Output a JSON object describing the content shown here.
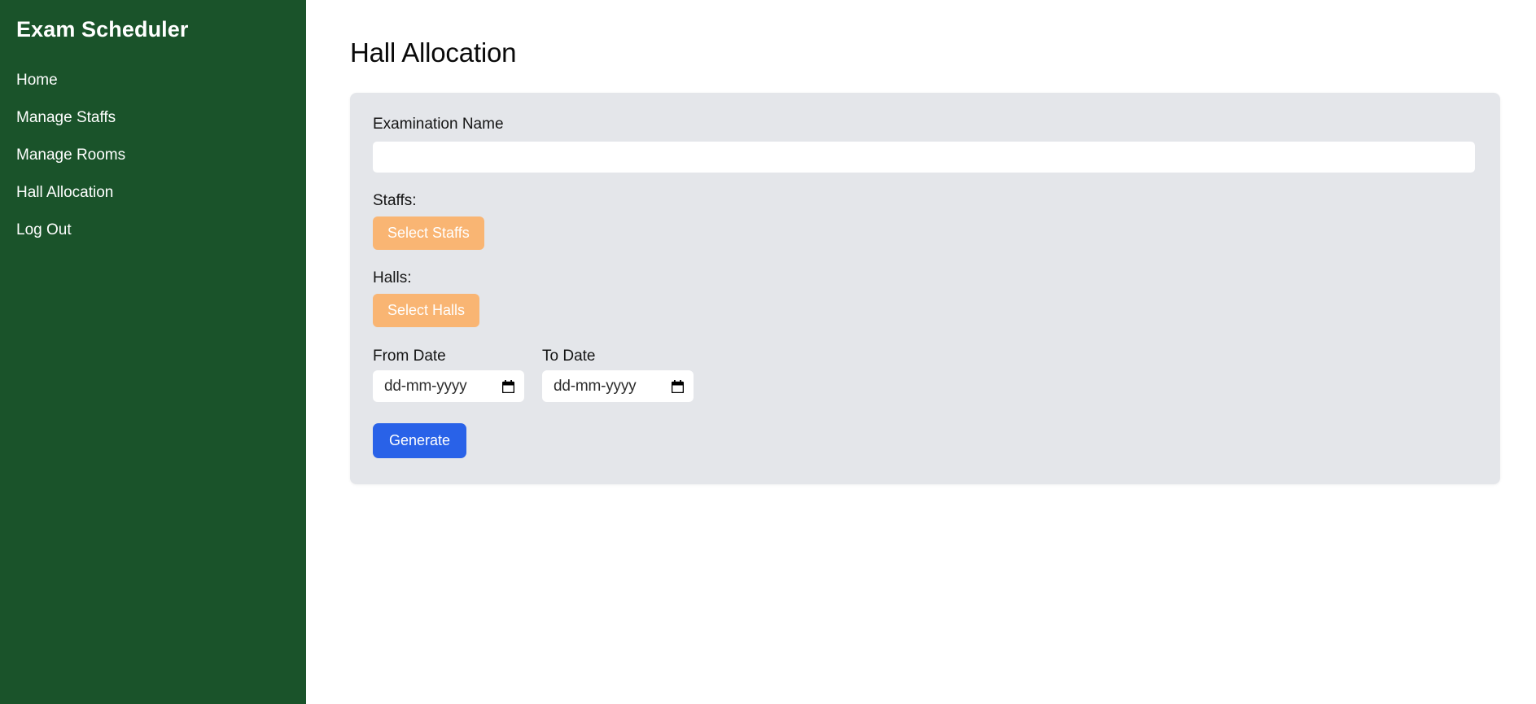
{
  "sidebar": {
    "title": "Exam Scheduler",
    "items": [
      {
        "label": "Home",
        "name": "sidebar-item-home"
      },
      {
        "label": "Manage Staffs",
        "name": "sidebar-item-manage-staffs"
      },
      {
        "label": "Manage Rooms",
        "name": "sidebar-item-manage-rooms"
      },
      {
        "label": "Hall Allocation",
        "name": "sidebar-item-hall-allocation"
      },
      {
        "label": "Log Out",
        "name": "sidebar-item-log-out"
      }
    ],
    "background_color": "#1a532a",
    "text_color": "#ffffff"
  },
  "main": {
    "page_title": "Hall Allocation",
    "form": {
      "exam_name": {
        "label": "Examination Name",
        "value": "",
        "placeholder": ""
      },
      "staffs": {
        "label": "Staffs:",
        "button_label": "Select Staffs"
      },
      "halls": {
        "label": "Halls:",
        "button_label": "Select Halls"
      },
      "from_date": {
        "label": "From Date",
        "value": "",
        "placeholder": "dd-mm-yyyy",
        "icon": "calendar-icon"
      },
      "to_date": {
        "label": "To Date",
        "value": "",
        "placeholder": "dd-mm-yyyy",
        "icon": "calendar-icon"
      },
      "submit": {
        "label": "Generate"
      }
    },
    "colors": {
      "card_background": "#e4e6ea",
      "select_button": "#f9b573",
      "generate_button": "#2962e8",
      "input_background": "#ffffff"
    }
  }
}
